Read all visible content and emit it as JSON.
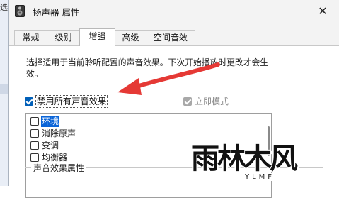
{
  "bg_window": {
    "edge_char": "选"
  },
  "window": {
    "title": "扬声器 属性",
    "close_glyph": "✕"
  },
  "tabs": [
    {
      "label": "常规",
      "active": false
    },
    {
      "label": "级别",
      "active": false
    },
    {
      "label": "增强",
      "active": true
    },
    {
      "label": "高级",
      "active": false
    },
    {
      "label": "空间音效",
      "active": false
    }
  ],
  "enhancements": {
    "description": "选择适用于当前聆听配置的声音效果。下次开始播放时更改才会生效。",
    "disable_all": {
      "label": "禁用所有声音效果",
      "checked": true
    },
    "immediate_mode": {
      "label": "立即模式",
      "checked": true,
      "disabled": true
    },
    "effects": [
      {
        "label": "环境",
        "checked": false,
        "selected": true
      },
      {
        "label": "消除原声",
        "checked": false,
        "selected": false
      },
      {
        "label": "变调",
        "checked": false,
        "selected": false
      },
      {
        "label": "均衡器",
        "checked": false,
        "selected": false
      }
    ],
    "properties_group_label": "声音效果属性"
  },
  "annotation": {
    "arrow_color": "#e53935"
  },
  "watermark": {
    "brand": "雨林木风",
    "sub": "YLMF"
  },
  "colors": {
    "accent": "#005fb8",
    "selection": "#0a64d8",
    "disabled": "#a8a8a8"
  }
}
